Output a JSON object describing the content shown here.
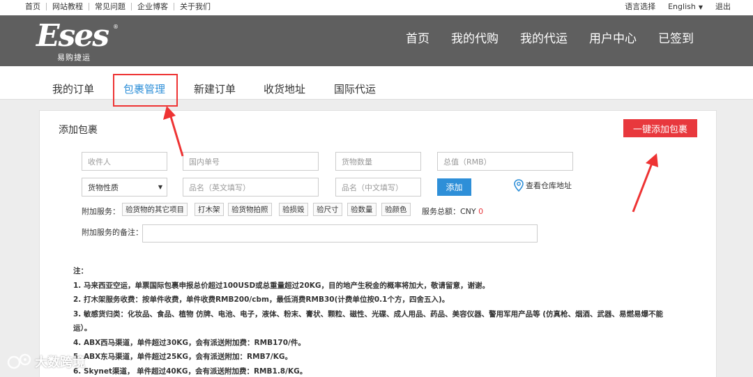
{
  "topbar": {
    "links": [
      "首页",
      "网站教程",
      "常见问题",
      "企业博客",
      "关于我们"
    ],
    "language_label": "语言选择",
    "language_value": "English",
    "logout": "退出"
  },
  "header": {
    "logo_text": "Eses",
    "logo_sub": "易购捷运",
    "nav": [
      "首页",
      "我的代购",
      "我的代运",
      "用户中心",
      "已签到"
    ]
  },
  "subtabs": [
    "我的订单",
    "包裹管理",
    "新建订单",
    "收货地址",
    "国际代运"
  ],
  "panel": {
    "title": "添加包裹",
    "onekey_button": "一键添加包裹",
    "fields": {
      "recipient": "收件人",
      "domestic_no": "国内单号",
      "quantity": "货物数量",
      "total_value": "总值（RMB）",
      "goods_type": "货物性质",
      "name_en": "品名（英文填写）",
      "name_cn": "品名（中文填写）"
    },
    "add_button": "添加",
    "warehouse_link": "查看仓库地址",
    "services_label": "附加服务：",
    "services": [
      "验货物的其它项目",
      "打木架",
      "验货物拍照",
      "验损毁",
      "验尺寸",
      "验数量",
      "验颜色"
    ],
    "services_total_label": "服务总额：CNY",
    "services_total_value": "0",
    "remark_label": "附加服务的备注："
  },
  "notes": [
    "注：",
    "1. 马来西亚空运，单票国际包裹申报总价超过100USD或总重量超过20KG，目的地产生税金的概率将加大，敬请留意，谢谢。",
    "2. 打木架服务收费：按单件收费，单件收费RMB200/cbm，最低消费RMB30(计费单位按0.1个方，四舍五入)。",
    "3. 敏感货归类：化妆品、食品、植物 仿牌、电池、电子，液体、粉末、膏状、颗粒、磁性、光碟、成人用品、药品、美容仪器、警用军用产品等 (仿真枪、烟酒、武器、易燃易爆不能",
    "运）。",
    "4. ABX西马渠道，单件超过30KG，会有派送附加费：RMB170/件。",
    "5. ABX东马渠道，单件超过25KG，会有派送附加：RMB7/KG。",
    "6. Skynet渠道， 单件超过40KG，会有派送附加费：RMB1.8/KG。"
  ],
  "watermark": "大数跨境",
  "colors": {
    "header_bg": "#5f5f5f",
    "accent_blue": "#2e8fd8",
    "accent_red": "#e8383d"
  }
}
